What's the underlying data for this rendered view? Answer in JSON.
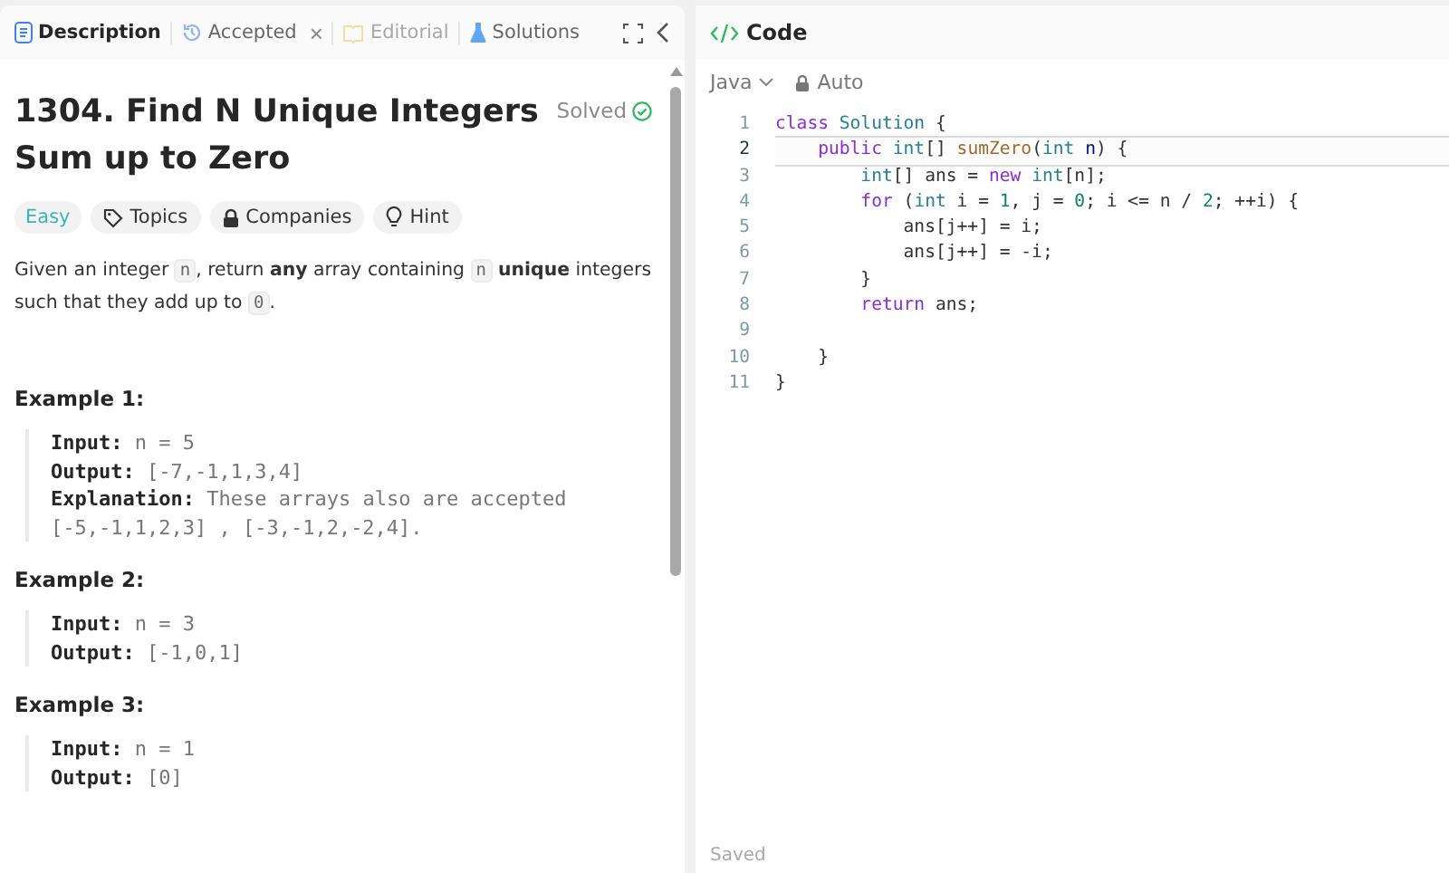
{
  "tabs": [
    {
      "label": "Description",
      "kind": "doc",
      "selected": true,
      "disabled": false,
      "closable": false
    },
    {
      "label": "Accepted",
      "kind": "history",
      "selected": false,
      "disabled": false,
      "closable": true,
      "close": "×"
    },
    {
      "label": "Editorial",
      "kind": "book",
      "selected": false,
      "disabled": true,
      "closable": false
    },
    {
      "label": "Solutions",
      "kind": "flask",
      "selected": false,
      "disabled": false,
      "closable": false
    }
  ],
  "problem": {
    "title": "1304. Find N Unique Integers Sum up to Zero",
    "status": "Solved",
    "solved": true,
    "difficulty": "Easy",
    "chips": [
      {
        "label": "Topics",
        "kind": "tag"
      },
      {
        "label": "Companies",
        "kind": "lock"
      },
      {
        "label": "Hint",
        "kind": "bulb"
      }
    ],
    "description": [
      {
        "text": "Given an integer ",
        "kind": "text"
      },
      {
        "text": "n",
        "kind": "code"
      },
      {
        "text": ", return ",
        "kind": "text"
      },
      {
        "text": "any",
        "kind": "bold"
      },
      {
        "text": " array containing ",
        "kind": "text"
      },
      {
        "text": "n",
        "kind": "code"
      },
      {
        "text": " unique",
        "kind": "bold"
      },
      {
        "text": " integers such that they add up to ",
        "kind": "text"
      },
      {
        "text": "0",
        "kind": "code"
      },
      {
        "text": ".",
        "kind": "text"
      }
    ],
    "examples": [
      {
        "title": "Example 1:",
        "lines": [
          {
            "label": "Input:",
            "value": "n = 5"
          },
          {
            "label": "Output:",
            "value": "[-7,-1,1,3,4]"
          },
          {
            "label": "Explanation:",
            "value": "These arrays also are accepted"
          },
          {
            "value": "[-5,-1,1,2,3] , [-3,-1,2,-2,4]."
          }
        ]
      },
      {
        "title": "Example 2:",
        "lines": [
          {
            "label": "Input:",
            "value": "n = 3"
          },
          {
            "label": "Output:",
            "value": "[-1,0,1]"
          }
        ]
      },
      {
        "title": "Example 3:",
        "lines": [
          {
            "label": "Input:",
            "value": "n = 1"
          },
          {
            "label": "Output:",
            "value": "[0]"
          }
        ]
      }
    ]
  },
  "editor": {
    "title": "Code",
    "language": "Java",
    "mode": "Auto",
    "status": "Saved",
    "lines": [
      {
        "number": "1",
        "selected": false,
        "tokens": [
          {
            "text": "class ",
            "kind": "keyword"
          },
          {
            "text": "Solution",
            "kind": "type"
          },
          {
            "text": " {",
            "kind": "plain"
          }
        ]
      },
      {
        "number": "2",
        "selected": true,
        "tokens": [
          {
            "text": "    public ",
            "kind": "keyword"
          },
          {
            "text": "int",
            "kind": "type"
          },
          {
            "text": "[] ",
            "kind": "plain"
          },
          {
            "text": "sumZero",
            "kind": "function"
          },
          {
            "text": "(",
            "kind": "plain"
          },
          {
            "text": "int ",
            "kind": "type"
          },
          {
            "text": "n",
            "kind": "variable"
          },
          {
            "text": ") {",
            "kind": "plain"
          }
        ]
      },
      {
        "number": "3",
        "selected": false,
        "tokens": [
          {
            "text": "        int",
            "kind": "type"
          },
          {
            "text": "[] ans = ",
            "kind": "plain"
          },
          {
            "text": "new ",
            "kind": "keyword"
          },
          {
            "text": "int",
            "kind": "type"
          },
          {
            "text": "[n];",
            "kind": "plain"
          }
        ]
      },
      {
        "number": "4",
        "selected": false,
        "tokens": [
          {
            "text": "        for ",
            "kind": "keyword"
          },
          {
            "text": "(",
            "kind": "plain"
          },
          {
            "text": "int ",
            "kind": "type"
          },
          {
            "text": "i = ",
            "kind": "plain"
          },
          {
            "text": "1",
            "kind": "number"
          },
          {
            "text": ", j = ",
            "kind": "plain"
          },
          {
            "text": "0",
            "kind": "number"
          },
          {
            "text": "; i <= n / ",
            "kind": "plain"
          },
          {
            "text": "2",
            "kind": "number"
          },
          {
            "text": "; ++i) {",
            "kind": "plain"
          }
        ]
      },
      {
        "number": "5",
        "selected": false,
        "tokens": [
          {
            "text": "            ans[j++] = i;",
            "kind": "plain"
          }
        ]
      },
      {
        "number": "6",
        "selected": false,
        "tokens": [
          {
            "text": "            ans[j++] = -i;",
            "kind": "plain"
          }
        ]
      },
      {
        "number": "7",
        "selected": false,
        "tokens": [
          {
            "text": "        }",
            "kind": "plain"
          }
        ]
      },
      {
        "number": "8",
        "selected": false,
        "tokens": [
          {
            "text": "        return ",
            "kind": "keyword"
          },
          {
            "text": "ans;",
            "kind": "plain"
          }
        ]
      },
      {
        "number": "9",
        "selected": false
      },
      {
        "number": "10",
        "selected": false,
        "tokens": [
          {
            "text": "    }",
            "kind": "plain"
          }
        ]
      },
      {
        "number": "11",
        "selected": false,
        "tokens": [
          {
            "text": "}",
            "kind": "plain"
          }
        ]
      }
    ]
  }
}
